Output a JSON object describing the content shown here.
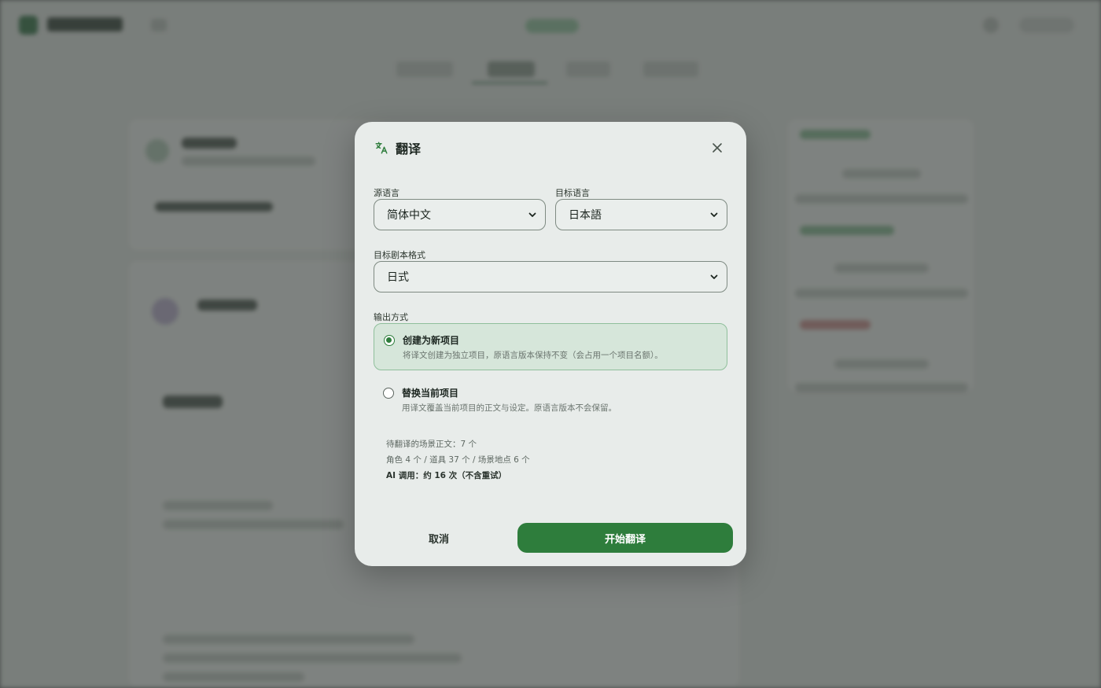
{
  "dialog": {
    "title": "翻译",
    "close_label": "×",
    "source_language": {
      "label": "源语言",
      "value": "简体中文"
    },
    "target_language": {
      "label": "目标语言",
      "value": "日本語"
    },
    "script_format": {
      "label": "目标剧本格式",
      "value": "日式"
    },
    "output_mode": {
      "label": "输出方式",
      "options": [
        {
          "title": "创建为新项目",
          "description": "将译文创建为独立项目，原语言版本保持不变（会占用一个项目名额）。",
          "selected": true
        },
        {
          "title": "替换当前项目",
          "description": "用译文覆盖当前项目的正文与设定。原语言版本不会保留。",
          "selected": false
        }
      ]
    },
    "stats": {
      "scenes": "待翻译的场景正文：7 个",
      "assets": "角色 4 个 / 道具 37 个 / 场景地点 6 个",
      "ai_calls": "AI 调用：约 16 次（不含重试）"
    },
    "cancel_label": "取消",
    "start_label": "开始翻译"
  },
  "colors": {
    "accent": "#2e7d3c",
    "selected_bg": "#d6e6da",
    "modal_bg": "#e8ecea"
  },
  "icons": {
    "title": "translate-icon",
    "close": "close-icon",
    "dropdown": "chevron-down-icon"
  }
}
